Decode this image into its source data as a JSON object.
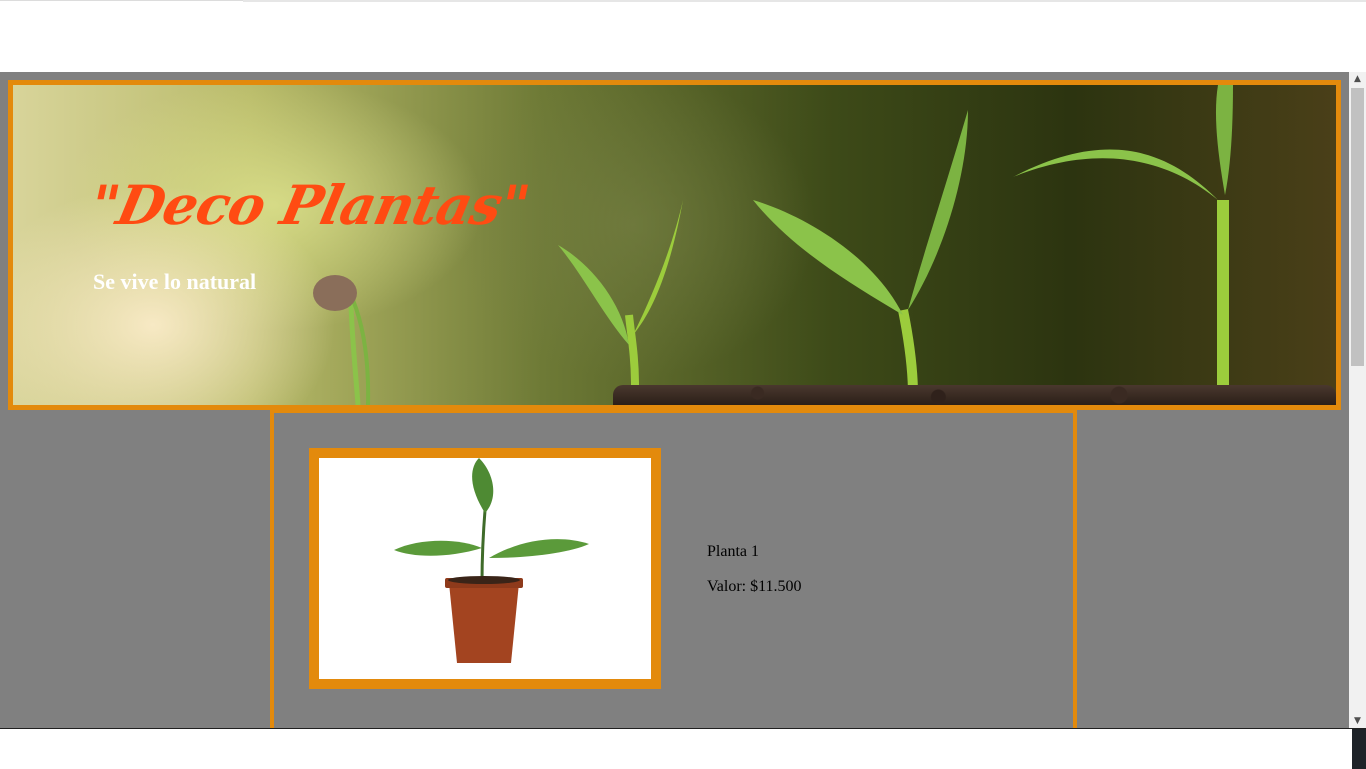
{
  "header": {
    "brand": "\"Deco Plantas\"",
    "tagline": "Se vive lo natural"
  },
  "product": {
    "name": "Planta 1",
    "price": "Valor: $11.500"
  },
  "colors": {
    "accent_border": "#e38a0c",
    "brand_text": "#ff4b12",
    "page_background": "#808080"
  },
  "icons": {
    "scroll_up": "triangle-up",
    "scroll_down": "triangle-down"
  }
}
